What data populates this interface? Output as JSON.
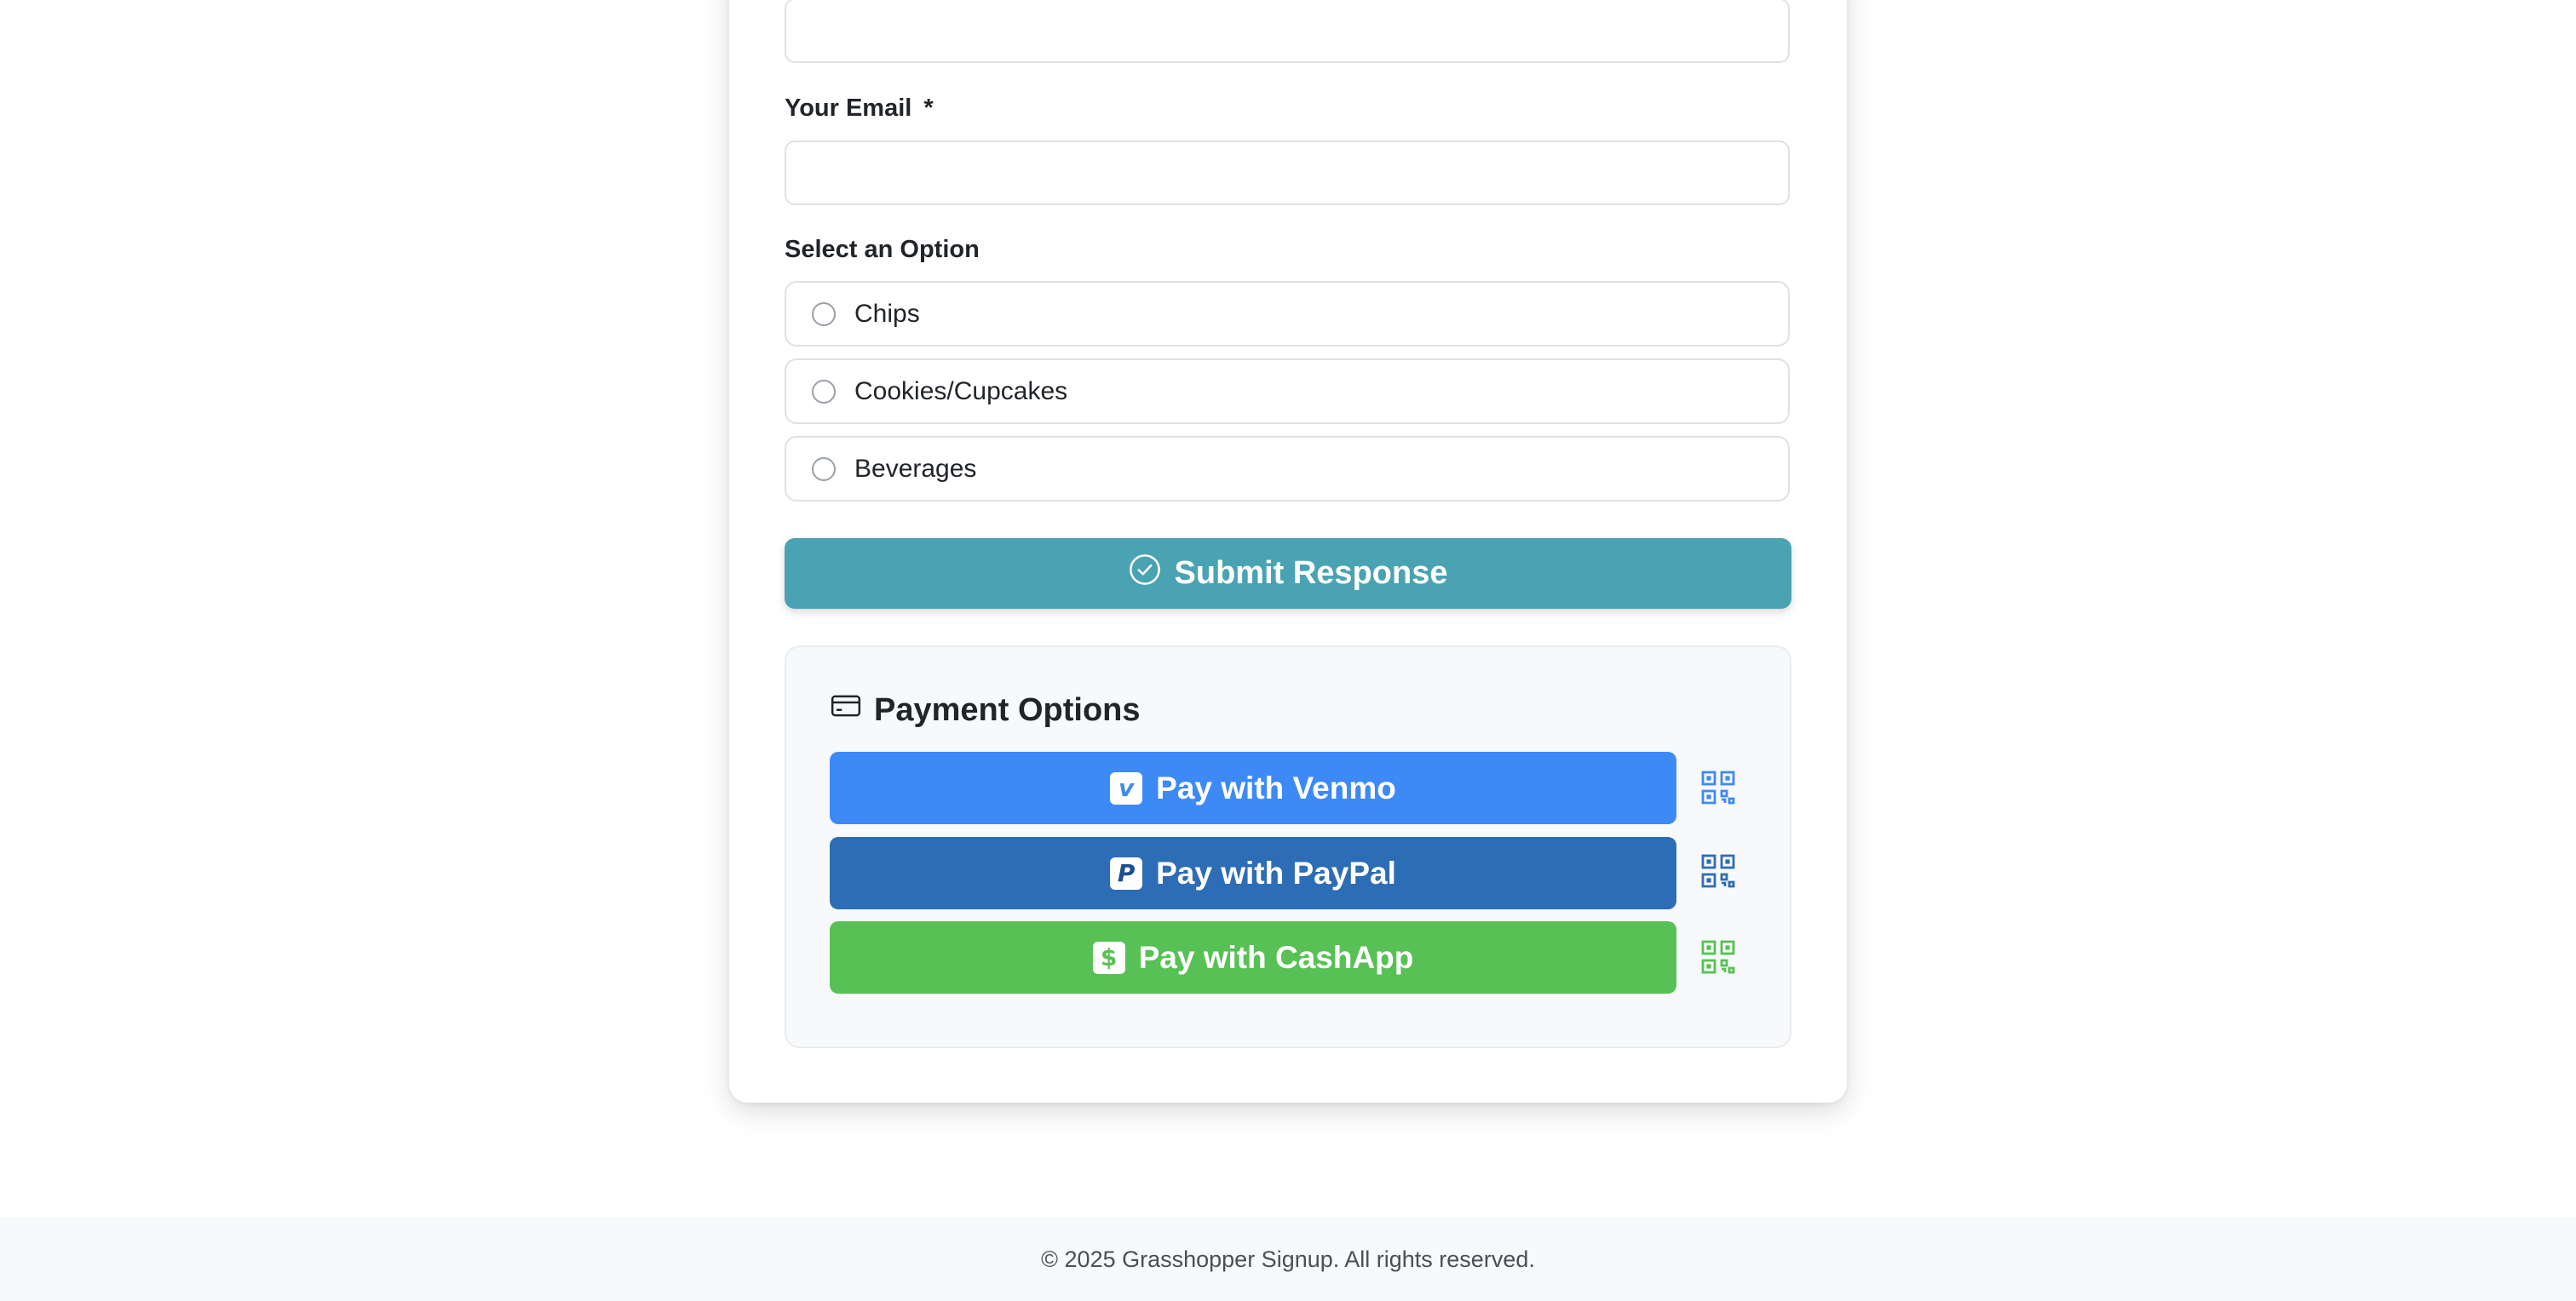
{
  "form": {
    "email_label": "Your Email",
    "required_marker": "*",
    "option_label": "Select an Option",
    "options": [
      {
        "label": "Chips",
        "selected": false
      },
      {
        "label": "Cookies/Cupcakes",
        "selected": false
      },
      {
        "label": "Beverages",
        "selected": false
      }
    ],
    "submit_label": "Submit Response"
  },
  "payment": {
    "title": "Payment Options",
    "methods": [
      {
        "label": "Pay with Venmo",
        "logo": "venmo-icon",
        "color": "#3d8af7"
      },
      {
        "label": "Pay with PayPal",
        "logo": "paypal-icon",
        "color": "#2d6db5"
      },
      {
        "label": "Pay with CashApp",
        "logo": "cashapp-icon",
        "color": "#58c155"
      }
    ]
  },
  "footer": {
    "text": "© 2025 Grasshopper Signup. All rights reserved."
  },
  "colors": {
    "accent": "#4aa3b2",
    "venmo": "#3d8af7",
    "paypal": "#2d6db5",
    "cashapp": "#58c155"
  }
}
